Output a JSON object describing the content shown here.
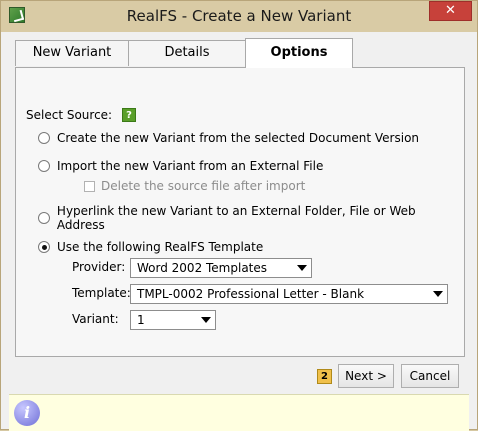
{
  "window": {
    "title": "RealFS - Create a New Variant",
    "close_label": "✕"
  },
  "tabs": [
    {
      "label": "New Variant",
      "active": false
    },
    {
      "label": "Details",
      "active": false
    },
    {
      "label": "Options",
      "active": true
    }
  ],
  "options": {
    "select_source_label": "Select Source:",
    "help_icon_glyph": "?",
    "radios": [
      {
        "label": "Create the new Variant from the selected Document Version",
        "checked": false
      },
      {
        "label": "Import the new Variant from an External File",
        "checked": false
      },
      {
        "label": "Hyperlink the new Variant to an External Folder, File or Web Address",
        "checked": false
      },
      {
        "label": "Use the following RealFS Template",
        "checked": true
      }
    ],
    "delete_source_label": "Delete the source file after import",
    "delete_source_checked": false,
    "provider_label": "Provider:",
    "provider_value": "Word 2002 Templates",
    "template_label": "Template:",
    "template_value": "TMPL-0002 Professional Letter - Blank",
    "variant_label": "Variant:",
    "variant_value": "1"
  },
  "footer": {
    "step_badge": "2",
    "next_label": "Next >",
    "cancel_label": "Cancel"
  },
  "infobar": {
    "icon_glyph": "i"
  },
  "colors": {
    "titlebar": "#d9cba5",
    "close_button": "#c7413a",
    "infobar": "#ffffe0",
    "help_icon": "#5a9f2a"
  }
}
